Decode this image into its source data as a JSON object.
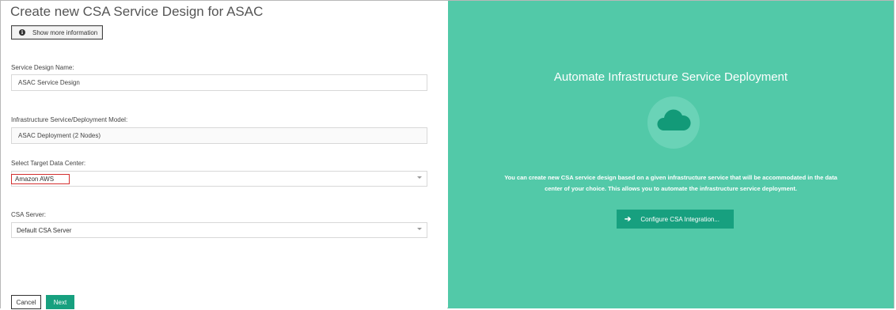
{
  "form": {
    "title": "Create new CSA Service Design for ASAC",
    "info_button": "Show more information",
    "service_design_name": {
      "label": "Service Design Name:",
      "value": "ASAC Service Design"
    },
    "deployment_model": {
      "label": "Infrastructure Service/Deployment Model:",
      "value": "ASAC Deployment (2 Nodes)"
    },
    "target_data_center": {
      "label": "Select Target Data Center:",
      "value": "Amazon AWS"
    },
    "csa_server": {
      "label": "CSA Server:",
      "value": "Default CSA Server"
    },
    "cancel_label": "Cancel",
    "next_label": "Next"
  },
  "promo": {
    "title": "Automate Infrastructure Service Deployment",
    "text_line1": "You can create new CSA service design based on a given infrastructure service that will be accommodated in the data",
    "text_line2": "center of your choice. This allows you to automate the infrastructure service deployment.",
    "button_label": "Configure CSA Integration...",
    "icon": "cloud-icon"
  },
  "colors": {
    "accent": "#52c9a8",
    "button": "#17a07f",
    "highlight_border": "#d32f2f"
  }
}
